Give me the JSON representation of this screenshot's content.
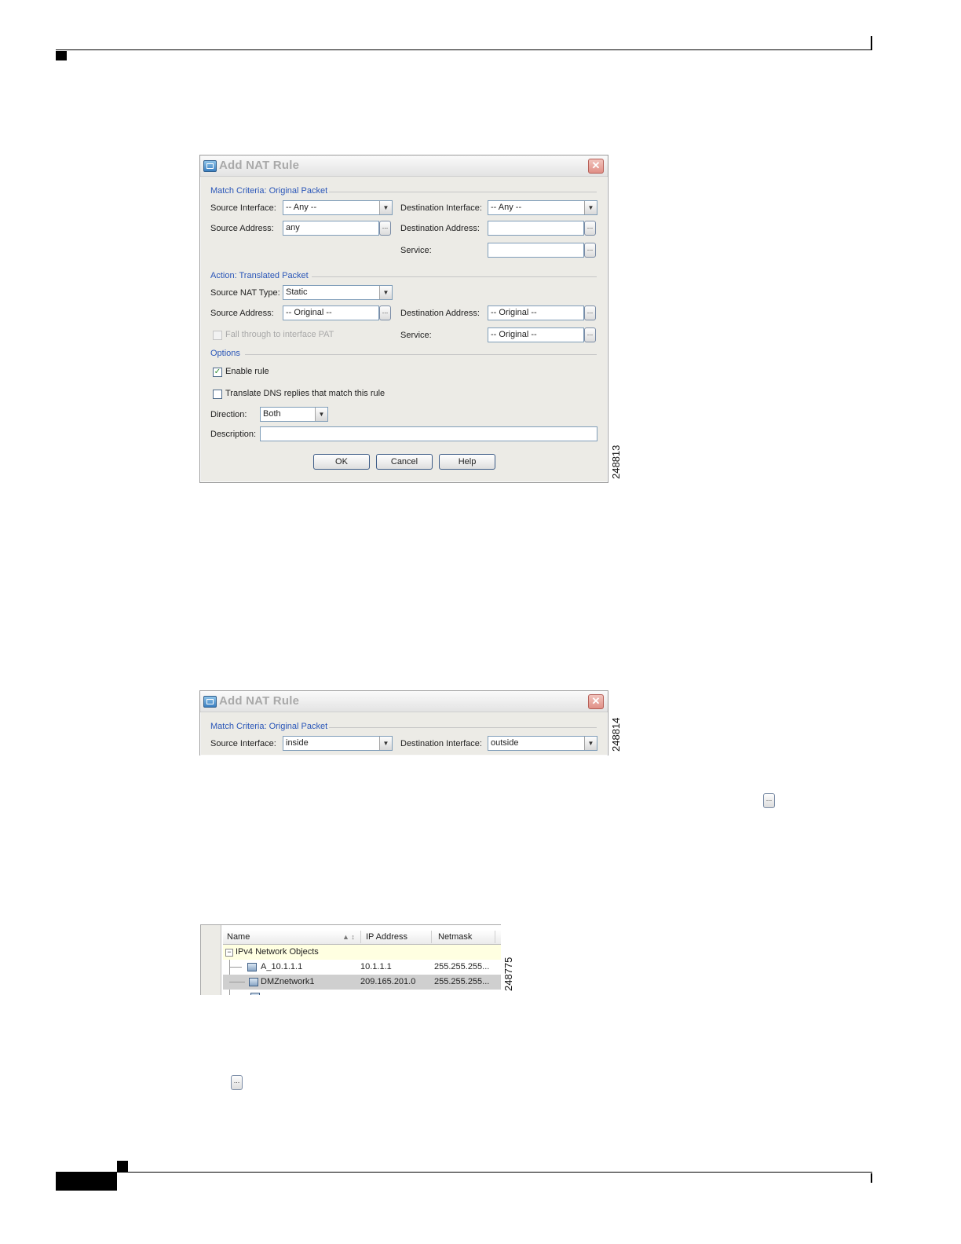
{
  "dialog1": {
    "title": "Add NAT Rule",
    "close_glyph": "✕",
    "figure_number": "248813",
    "match_section": "Match Criteria: Original Packet",
    "source_interface_label": "Source Interface:",
    "source_interface_value": "-- Any --",
    "destination_interface_label": "Destination Interface:",
    "destination_interface_value": "-- Any --",
    "source_address_label": "Source Address:",
    "source_address_value": "any",
    "destination_address_label": "Destination Address:",
    "destination_address_value": "",
    "service_label": "Service:",
    "service_value": "",
    "action_section": "Action: Translated Packet",
    "source_nat_type_label": "Source NAT Type:",
    "source_nat_type_value": "Static",
    "t_source_address_label": "Source Address:",
    "t_source_address_value": "-- Original --",
    "t_destination_address_label": "Destination Address:",
    "t_destination_address_value": "-- Original --",
    "fall_through_label": "Fall through to interface PAT",
    "t_service_label": "Service:",
    "t_service_value": "-- Original --",
    "options_section": "Options",
    "enable_rule_label": "Enable rule",
    "enable_rule_checked": true,
    "translate_dns_label": "Translate DNS replies that match this rule",
    "translate_dns_checked": false,
    "direction_label": "Direction:",
    "direction_value": "Both",
    "description_label": "Description:",
    "description_value": "",
    "ok_label": "OK",
    "cancel_label": "Cancel",
    "help_label": "Help"
  },
  "dialog2": {
    "title": "Add NAT Rule",
    "close_glyph": "✕",
    "figure_number": "248814",
    "match_section": "Match Criteria: Original Packet",
    "source_interface_label": "Source Interface:",
    "source_interface_value": "inside",
    "destination_interface_label": "Destination Interface:",
    "destination_interface_value": "outside"
  },
  "inline_browse_glyph": "...",
  "object_table": {
    "figure_number": "248775",
    "columns": [
      "Name",
      "IP Address",
      "Netmask"
    ],
    "sort_glyph": "▲ ↕",
    "group_label": "IPv4 Network Objects",
    "rows": [
      {
        "name": "A_10.1.1.1",
        "ip": "10.1.1.1",
        "netmask": "255.255.255...",
        "icon": "host-icon"
      },
      {
        "name": "DMZnetwork1",
        "ip": "209.165.201.0",
        "netmask": "255.255.255...",
        "icon": "network-icon"
      }
    ]
  },
  "icons": {
    "combo_arrow": "▼",
    "browse": "...",
    "check": "✓",
    "minus": "−"
  }
}
